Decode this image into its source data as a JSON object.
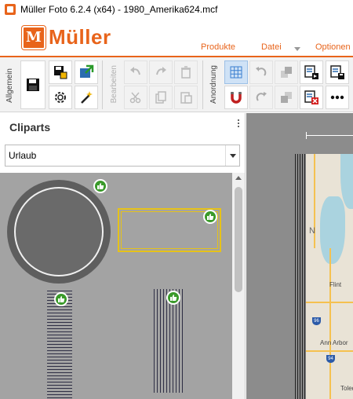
{
  "window": {
    "title": "Müller Foto 6.2.4 (x64) - 1980_Amerika624.mcf"
  },
  "header": {
    "logo_letter": "M",
    "logo_text": "Müller",
    "menu": [
      {
        "label": "Produkte"
      },
      {
        "label": "Datei"
      },
      {
        "label": "Optionen"
      }
    ]
  },
  "ribbon": {
    "groups": {
      "allgemein": "Allgemein",
      "bearbeiten": "Bearbeiten",
      "anordnung": "Anordnung"
    }
  },
  "cliparts_panel": {
    "title": "Cliparts",
    "category_selected": "Urlaub"
  },
  "colors": {
    "accent": "#e8641b",
    "badge": "#3a9a2a",
    "highlight": "#e6c21a"
  },
  "map": {
    "labels": [
      "Flint",
      "Ann Arbor",
      "Toledo",
      "N"
    ],
    "shields": [
      "96",
      "94"
    ]
  }
}
